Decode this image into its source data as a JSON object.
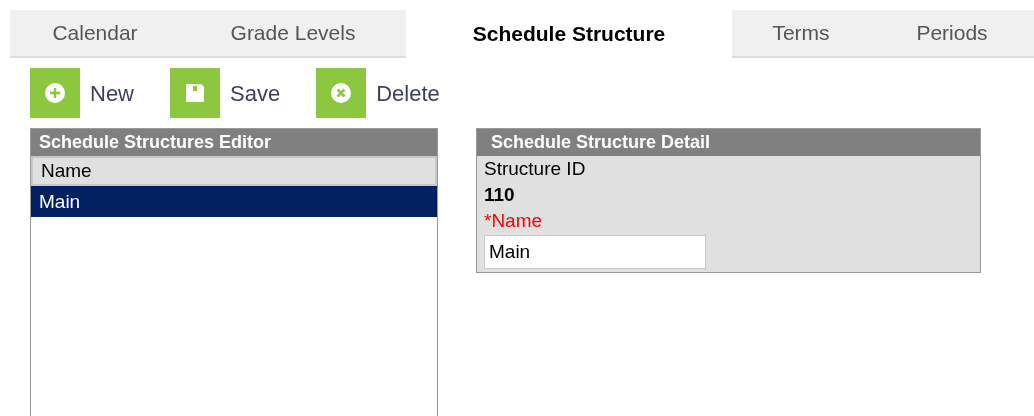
{
  "tabs": [
    {
      "label": "Calendar",
      "selected": false
    },
    {
      "label": "Grade Levels",
      "selected": false
    },
    {
      "label": "Schedule Structure",
      "selected": true
    },
    {
      "label": "Terms",
      "selected": false
    },
    {
      "label": "Periods",
      "selected": false
    }
  ],
  "toolbar": [
    {
      "kind": "new",
      "label": "New"
    },
    {
      "kind": "save",
      "label": "Save"
    },
    {
      "kind": "delete",
      "label": "Delete"
    }
  ],
  "editor": {
    "title": "Schedule Structures Editor",
    "column": "Name",
    "rows": [
      {
        "name": "Main",
        "selected": true
      }
    ]
  },
  "detail": {
    "title": "Schedule Structure Detail",
    "id_label": "Structure ID",
    "id_value": "110",
    "name_label": "*Name",
    "name_value": "Main"
  }
}
